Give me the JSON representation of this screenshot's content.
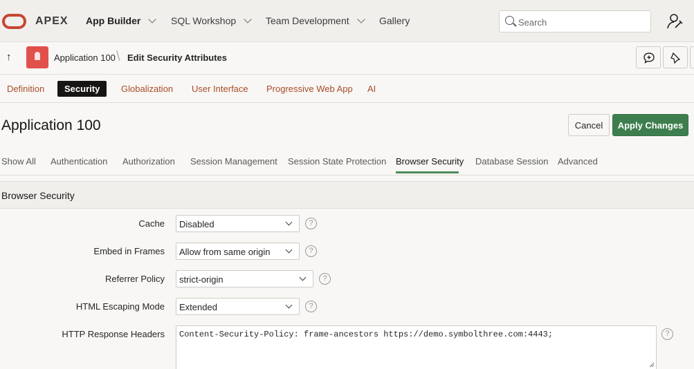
{
  "header": {
    "brand": "APEX",
    "nav": [
      {
        "label": "App Builder",
        "has_menu": true
      },
      {
        "label": "SQL Workshop",
        "has_menu": true
      },
      {
        "label": "Team Development",
        "has_menu": true
      },
      {
        "label": "Gallery",
        "has_menu": false
      }
    ],
    "search_placeholder": "Search",
    "icons": {
      "logo": "oracle-ring-logo",
      "search": "search-icon",
      "user": "user-settings-icon"
    }
  },
  "breadcrumb": {
    "up_icon": "↑",
    "app": "Application 100",
    "separator": "\\",
    "page": "Edit Security Attributes",
    "tools": [
      "add-comment-icon",
      "pin-icon"
    ]
  },
  "top_tabs": [
    {
      "label": "Definition",
      "active": false
    },
    {
      "label": "Security",
      "active": true
    },
    {
      "label": "Globalization",
      "active": false
    },
    {
      "label": "User Interface",
      "active": false
    },
    {
      "label": "Progressive Web App",
      "active": false
    },
    {
      "label": "AI",
      "active": false
    }
  ],
  "page": {
    "title": "Application 100",
    "cancel_label": "Cancel",
    "apply_label": "Apply Changes"
  },
  "sub_tabs": [
    {
      "label": "Show All",
      "active": false
    },
    {
      "label": "Authentication",
      "active": false
    },
    {
      "label": "Authorization",
      "active": false
    },
    {
      "label": "Session Management",
      "active": false
    },
    {
      "label": "Session State Protection",
      "active": false
    },
    {
      "label": "Browser Security",
      "active": true
    },
    {
      "label": "Database Session",
      "active": false
    },
    {
      "label": "Advanced",
      "active": false
    }
  ],
  "region": {
    "title": "Browser Security",
    "fields": [
      {
        "label": "Cache",
        "value": "Disabled"
      },
      {
        "label": "Embed in Frames",
        "value": "Allow from same origin"
      },
      {
        "label": "Referrer Policy",
        "value": "strict-origin"
      },
      {
        "label": "HTML Escaping Mode",
        "value": "Extended"
      },
      {
        "label": "HTTP Response Headers",
        "value": "Content-Security-Policy: frame-ancestors https://demo.symbolthree.com:4443;"
      }
    ],
    "help_glyph": "?"
  },
  "colors": {
    "accent": "#c74634",
    "apply_button": "#3e7e4e",
    "tab_link": "#a84c27",
    "active_tab_bg": "#161513"
  }
}
